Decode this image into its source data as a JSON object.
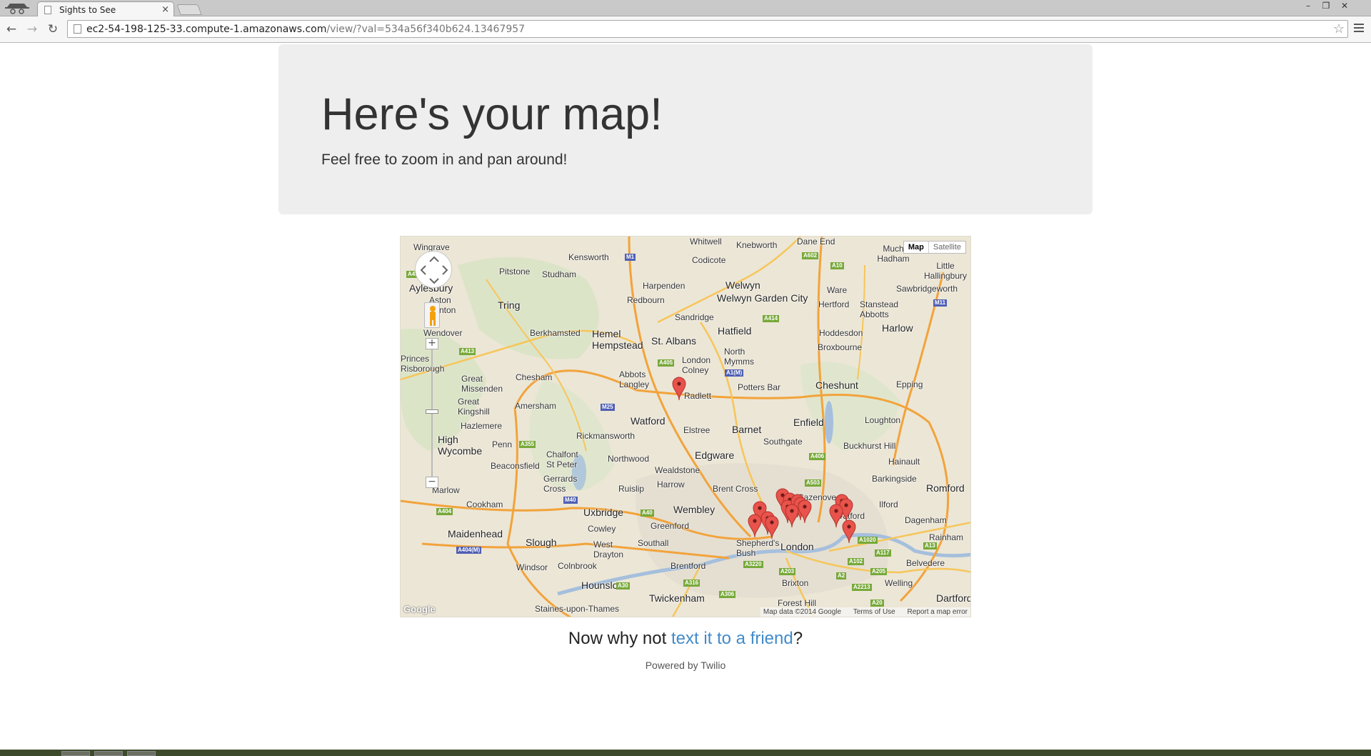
{
  "browser": {
    "tab_title": "Sights to See",
    "tab_close": "×",
    "url_host": "ec2-54-198-125-33.compute-1.amazonaws.com",
    "url_path": "/view/?val=534a56f340b624.13467957"
  },
  "jumbotron": {
    "title": "Here's your map!",
    "subtitle": "Feel free to zoom in and pan around!"
  },
  "map": {
    "type_controls": {
      "map": "Map",
      "satellite": "Satellite"
    },
    "attribution": {
      "data": "Map data ©2014 Google",
      "terms": "Terms of Use",
      "report": "Report a map error"
    },
    "logo": "Google",
    "places": [
      "Wingrave",
      "Kensworth",
      "Whitwell",
      "Knebworth",
      "Dane End",
      "Much Hadham",
      "Little Hallingbury",
      "Aylesbury",
      "Pitstone",
      "Studham",
      "Codicote",
      "Harpenden",
      "Welwyn",
      "Welwyn Garden City",
      "Ware",
      "Sawbridgeworth",
      "Aston Clinton",
      "Tring",
      "Redbourn",
      "Hertford",
      "Stanstead Abbotts",
      "Sandridge",
      "Wendover",
      "Berkhamsted",
      "Hemel Hempstead",
      "St. Albans",
      "Hatfield",
      "Hoddesdon",
      "Harlow",
      "Princes Risborough",
      "Broxbourne",
      "Abbots Langley",
      "London Colney",
      "North Mymms",
      "Great Missenden",
      "Chesham",
      "Potters Bar",
      "Cheshunt",
      "Epping",
      "Great Kingshill",
      "Amersham",
      "Radlett",
      "Watford",
      "Hazlemere",
      "Elstree",
      "Barnet",
      "Enfield",
      "Loughton",
      "High Wycombe",
      "Penn",
      "Rickmansworth",
      "Southgate",
      "Buckhurst Hill",
      "Chalfont St Peter",
      "Northwood",
      "Edgware",
      "Hainault",
      "Beaconsfield",
      "Gerrards Cross",
      "Wealdstone",
      "Barkingside",
      "Marlow",
      "Harrow",
      "Brent Cross",
      "Romford",
      "Ruislip",
      "Cazenove",
      "Cookham",
      "Wembley",
      "Ilford",
      "Uxbridge",
      "Stratford",
      "Dagenham",
      "Maidenhead",
      "Greenford",
      "Cowley",
      "Rainham",
      "Slough",
      "Southall",
      "Shepherd's Bush",
      "London",
      "West Drayton",
      "Belvedere",
      "Windsor",
      "Colnbrook",
      "Brentford",
      "Brixton",
      "Hounslow",
      "Welling",
      "Twickenham",
      "Dartford",
      "Staines-upon-Thames",
      "Forest Hill",
      "Radlett"
    ],
    "roads": [
      "A41",
      "M1",
      "A602",
      "A10",
      "M11",
      "A414",
      "A413",
      "A405",
      "A1(M)",
      "M25",
      "A355",
      "A406",
      "A503",
      "A404",
      "M40",
      "A40",
      "A1020",
      "A117",
      "A13",
      "A102",
      "A3220",
      "A203",
      "A205",
      "A316",
      "A306",
      "A2",
      "A2213",
      "A20",
      "A30",
      "A404(M)"
    ],
    "marker_count": 16
  },
  "cta": {
    "prefix": "Now why not ",
    "link": "text it to a friend",
    "suffix": "?"
  },
  "footer": {
    "powered_by": "Powered by Twilio"
  }
}
